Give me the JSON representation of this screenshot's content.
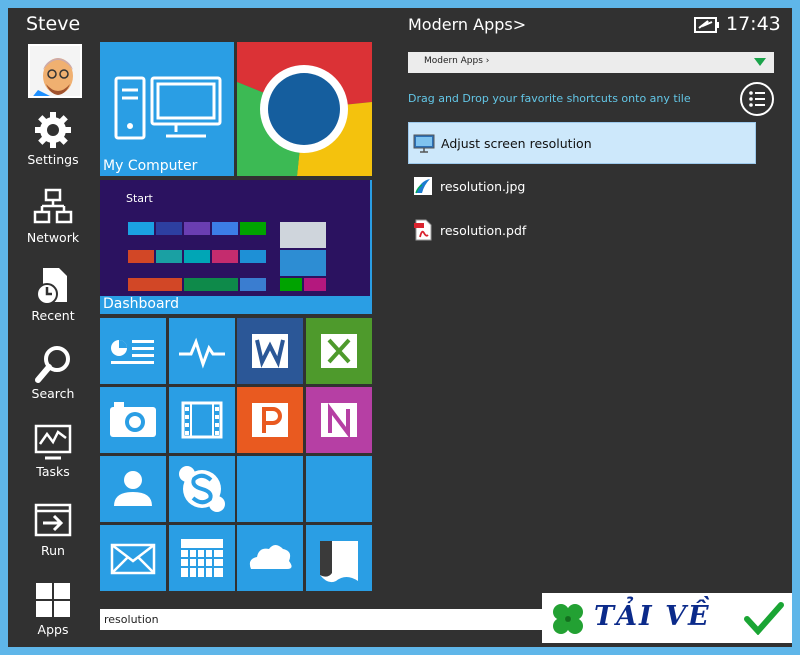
{
  "user": {
    "name": "Steve"
  },
  "nav": [
    {
      "label": "Settings",
      "icon": "gear-icon"
    },
    {
      "label": "Network",
      "icon": "network-icon"
    },
    {
      "label": "Recent",
      "icon": "recent-icon"
    },
    {
      "label": "Search",
      "icon": "search-icon"
    },
    {
      "label": "Tasks",
      "icon": "tasks-icon"
    },
    {
      "label": "Run",
      "icon": "run-icon"
    },
    {
      "label": "Apps",
      "icon": "apps-icon"
    }
  ],
  "tiles": {
    "my_computer": "My Computer",
    "dashboard": "Dashboard",
    "mini_start": "Start"
  },
  "search": {
    "value": "resolution"
  },
  "panel": {
    "title": "Modern Apps>",
    "clock": "17:43",
    "dropdown": "Modern Apps ›",
    "hint": "Drag and Drop your favorite shortcuts onto any tile",
    "results": [
      {
        "label": "Adjust screen resolution",
        "icon": "display-settings-icon"
      },
      {
        "label": "resolution.jpg",
        "icon": "image-file-icon"
      },
      {
        "label": "resolution.pdf",
        "icon": "pdf-file-icon"
      }
    ]
  },
  "watermark": {
    "text": "TẢI VỀ"
  },
  "colors": {
    "tile_blue": "#2a9ee4",
    "office_word": "#2b5797",
    "office_excel": "#4e9a2c",
    "office_ppt": "#e95a20",
    "onenote": "#b63fa4",
    "hint": "#63c6e6"
  }
}
